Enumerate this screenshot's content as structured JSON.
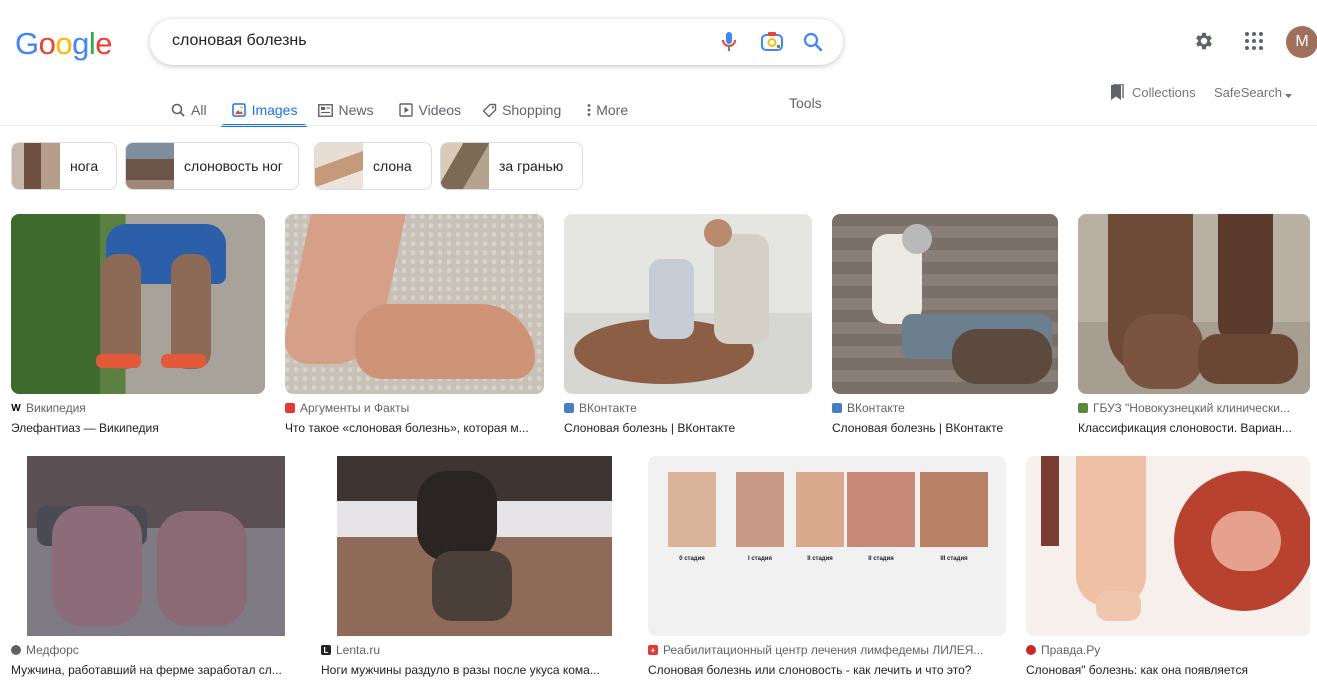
{
  "header": {
    "logo_letters": [
      "G",
      "o",
      "o",
      "g",
      "l",
      "e"
    ],
    "logo_colors": [
      "#4285f4",
      "#ea4335",
      "#fbbc05",
      "#4285f4",
      "#34a853",
      "#ea4335"
    ],
    "search_query": "слоновая болезнь",
    "avatar_letter": "M"
  },
  "tabs": [
    {
      "label": "All",
      "icon": "search-icon"
    },
    {
      "label": "Images",
      "icon": "image-icon",
      "active": true
    },
    {
      "label": "News",
      "icon": "news-icon"
    },
    {
      "label": "Videos",
      "icon": "video-icon"
    },
    {
      "label": "Shopping",
      "icon": "tag-icon"
    },
    {
      "label": "More",
      "icon": "more-vert-icon"
    }
  ],
  "tools_label": "Tools",
  "collections_label": "Collections",
  "safesearch_label": "SafeSearch",
  "chips": [
    {
      "label": "нога",
      "thumb_color": "#8a6a5a"
    },
    {
      "label": "слоновость ног",
      "thumb_color": "#6b5d52"
    },
    {
      "label": "слона",
      "thumb_color": "#c9a48a"
    },
    {
      "label": "за гранью",
      "thumb_color": "#7a6b5d"
    }
  ],
  "results_row1": [
    {
      "source": "Википедия",
      "title": "Элефантиаз — Википедия",
      "fav": "W",
      "fav_color": "#ffffff",
      "fav_text": "#000000",
      "img_color": "#4a6a3c"
    },
    {
      "source": "Аргументы и Факты",
      "title": "Что такое «слоновая болезнь», которая м...",
      "fav": "",
      "fav_color": "#e53935",
      "fav_text": "#ffffff",
      "img_color": "#c9a38c"
    },
    {
      "source": "ВКонтакте",
      "title": "Слоновая болезнь | ВКонтакте",
      "fav": "",
      "fav_color": "#4680c2",
      "fav_text": "#ffffff",
      "img_color": "#a48070"
    },
    {
      "source": "ВКонтакте",
      "title": "Слоновая болезнь | ВКонтакте",
      "fav": "",
      "fav_color": "#4680c2",
      "fav_text": "#ffffff",
      "img_color": "#6f6660"
    },
    {
      "source": "ГБУЗ \"Новокузнецкий клинически...",
      "title": "Классификация слоновости. Вариан...",
      "fav": "",
      "fav_color": "#5c8a3a",
      "fav_text": "#ffffff",
      "img_color": "#7c5a45"
    }
  ],
  "results_row2": [
    {
      "source": "Медфорс",
      "title": "Мужчина, работавший на ферме заработал сл...",
      "fav": "",
      "fav_color": "#5f6368",
      "fav_text": "#ffffff",
      "img_color": "#6a6468"
    },
    {
      "source": "Lenta.ru",
      "title": "Ноги мужчины раздуло в разы после укуса кома...",
      "fav": "L",
      "fav_color": "#222222",
      "fav_text": "#ffffff",
      "img_color": "#5a4a42"
    },
    {
      "source": "Реабилитационный центр лечения лимфедемы ЛИЛЕЯ...",
      "title": "Слоновая болезнь или слоновость - как лечить и что это?",
      "fav": "+",
      "fav_color": "#e53935",
      "fav_text": "#ffffff",
      "img_color": "#f1f1f1"
    },
    {
      "source": "Правда.Ру",
      "title": "Слоновая\" болезнь: как она появляется",
      "fav": "",
      "fav_color": "#c62828",
      "fav_text": "#ffffff",
      "img_color": "#f6ede8"
    }
  ],
  "stage_labels": [
    "0 стадия",
    "I стадия",
    "II стадия",
    "II стадия",
    "III стадия"
  ]
}
